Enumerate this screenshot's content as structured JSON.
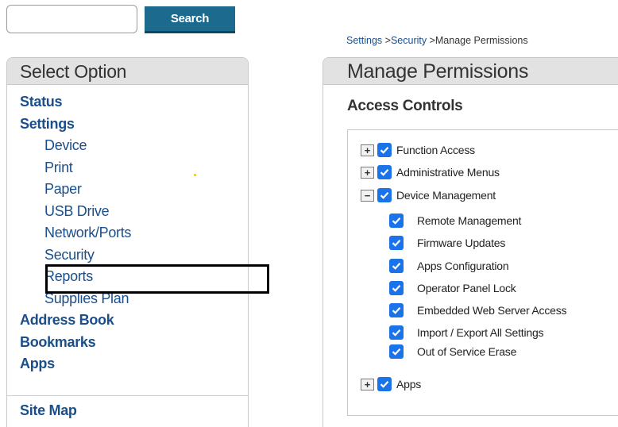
{
  "search": {
    "placeholder": "",
    "value": "",
    "button_label": "Search"
  },
  "breadcrumb": {
    "items": [
      "Settings",
      "Security",
      "Manage Permissions"
    ],
    "separator": " >"
  },
  "left_panel": {
    "title": "Select Option",
    "items": [
      {
        "label": "Status",
        "level": "main"
      },
      {
        "label": "Settings",
        "level": "main"
      },
      {
        "label": "Device",
        "level": "sub"
      },
      {
        "label": "Print",
        "level": "sub"
      },
      {
        "label": "Paper",
        "level": "sub"
      },
      {
        "label": "USB Drive",
        "level": "sub"
      },
      {
        "label": "Network/Ports",
        "level": "sub"
      },
      {
        "label": "Security",
        "level": "sub"
      },
      {
        "label": "Reports",
        "level": "sub"
      },
      {
        "label": "Supplies Plan",
        "level": "sub"
      },
      {
        "label": "Address Book",
        "level": "main"
      },
      {
        "label": "Bookmarks",
        "level": "main"
      },
      {
        "label": "Apps",
        "level": "main"
      }
    ],
    "site_map": "Site Map"
  },
  "right_panel": {
    "title": "Manage Permissions",
    "section_title": "Access Controls",
    "tree": [
      {
        "label": "Function Access",
        "expander": "+",
        "checked": true
      },
      {
        "label": "Administrative Menus",
        "expander": "+",
        "checked": true
      },
      {
        "label": "Device Management",
        "expander": "−",
        "checked": true,
        "children": [
          {
            "label": "Remote Management",
            "checked": true
          },
          {
            "label": "Firmware Updates",
            "checked": true
          },
          {
            "label": "Apps Configuration",
            "checked": true
          },
          {
            "label": "Operator Panel Lock",
            "checked": true
          },
          {
            "label": "Embedded Web Server Access",
            "checked": true
          },
          {
            "label": "Import / Export All Settings",
            "checked": true
          },
          {
            "label": "Out of Service Erase",
            "checked": true
          }
        ]
      },
      {
        "label": "Apps",
        "expander": "+",
        "checked": true
      }
    ]
  },
  "colors": {
    "accent": "#1c6a8e",
    "link": "#1a4f8b",
    "checkbox": "#1a73e8",
    "header_bg": "#e2e2e2"
  }
}
